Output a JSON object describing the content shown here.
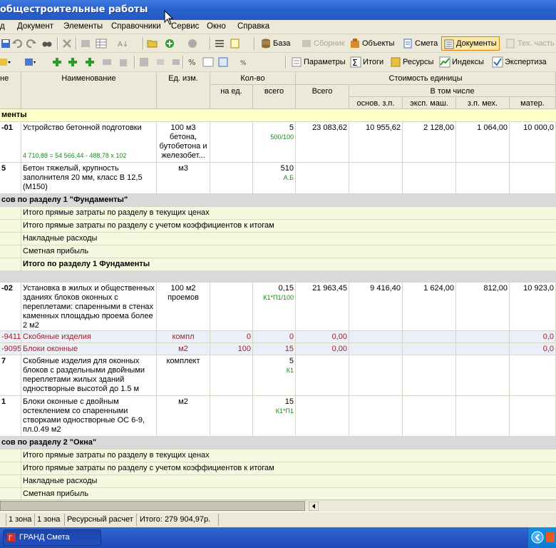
{
  "window": {
    "title": "общестроительные работы"
  },
  "menu": [
    "д",
    "Документ",
    "Элементы",
    "Справочники",
    "Сервис",
    "Окно",
    "Справка"
  ],
  "toolbar1": {
    "baza": "База",
    "sbornik": "Сборник",
    "obekty": "Объекты",
    "smeta": "Смета",
    "dokumenty": "Документы",
    "tekh": "Тех. часть"
  },
  "toolbar2": {
    "params": "Параметры",
    "itogi": "Итоги",
    "resursy": "Ресурсы",
    "indeksy": "Индексы",
    "ekspertiza": "Экспертиза"
  },
  "columns": {
    "obosn": "не",
    "name": "Наименование",
    "unit": "Ед. изм.",
    "qty": "Кол-во",
    "qty_per": "на ед.",
    "qty_total": "всего",
    "cost_unit": "Стоимость единицы",
    "total": "Всего",
    "incl": "В том числе",
    "zp": "основ. з.п.",
    "mash": "эксп. маш.",
    "zpmech": "з.п. мех.",
    "mater": "матер."
  },
  "rows": {
    "s1": "менты",
    "r1": {
      "code": "-01",
      "name": "Устройство бетонной подготовки",
      "unit": "100 м3 бетона, бутобетона и железобет...",
      "qty": "5",
      "coef": "500/100",
      "formula": "4 710,88 = 54 566,44 - 488,78 x 102",
      "total": "23 083,62",
      "zp": "10 955,62",
      "mash": "2 128,00",
      "zpmech": "1 064,00",
      "mater": "10 000,0"
    },
    "r2": {
      "code": "5",
      "name": "Бетон тяжелый, крупность заполнителя 20 мм, класс В 12,5 (М150)",
      "unit": "м3",
      "qty": "510",
      "coef": "А.Б"
    },
    "g1": "сов по разделу 1 \"Фундаменты\"",
    "t1a": "Итого прямые затраты по разделу в текущих ценах",
    "t1b": "Итого прямые затраты по разделу с учетом коэффициентов к итогам",
    "t1c": "Накладные расходы",
    "t1d": "Сметная прибыль",
    "t1e": "Итого по разделу 1 Фундаменты",
    "r3": {
      "code": "-02",
      "name": "Установка в жилых и общественных зданиях блоков оконных с переплетами: спаренными в стенах каменных площадью проема более 2 м2",
      "unit": "100 м2 проемов",
      "qty": "0,15",
      "coef": "К1*П1/100",
      "total": "21 963,45",
      "zp": "9 416,40",
      "mash": "1 624,00",
      "zpmech": "812,00",
      "mater": "10 923,0"
    },
    "r4": {
      "code": "-9411",
      "name": "Скобяные изделия",
      "unit": "компл",
      "per": "0",
      "qty": "0",
      "total": "0,00",
      "mater": "0,0"
    },
    "r5": {
      "code": "-9095",
      "name": "Блоки оконные",
      "unit": "м2",
      "per": "100",
      "qty": "15",
      "total": "0,00",
      "mater": "0,0"
    },
    "r6": {
      "code": "7",
      "name": "Скобяные изделия для оконных блоков с раздельными двойными переплетами жилых зданий одностворные высотой до 1.5 м",
      "unit": "комплект",
      "qty": "5",
      "coef": "К1"
    },
    "r7": {
      "code": "1",
      "name": "Блоки оконные с двойным остеклением со спаренными створками одностворные ОС 6-9, пл.0.49 м2",
      "unit": "м2",
      "qty": "15",
      "coef": "К1*П1"
    },
    "g2": "сов по разделу 2 \"Окна\"",
    "t2a": "Итого прямые затраты по разделу в текущих ценах",
    "t2b": "Итого прямые затраты по разделу с учетом коэффициентов к итогам",
    "t2c": "Накладные расходы",
    "t2d": "Сметная прибыль"
  },
  "status": {
    "a": "1 зона",
    "b": "1 зона",
    "c": "Ресурсный расчет",
    "d": "Итого: 279 904,97р."
  },
  "taskbar": {
    "app": "ГРАНД Смета"
  }
}
